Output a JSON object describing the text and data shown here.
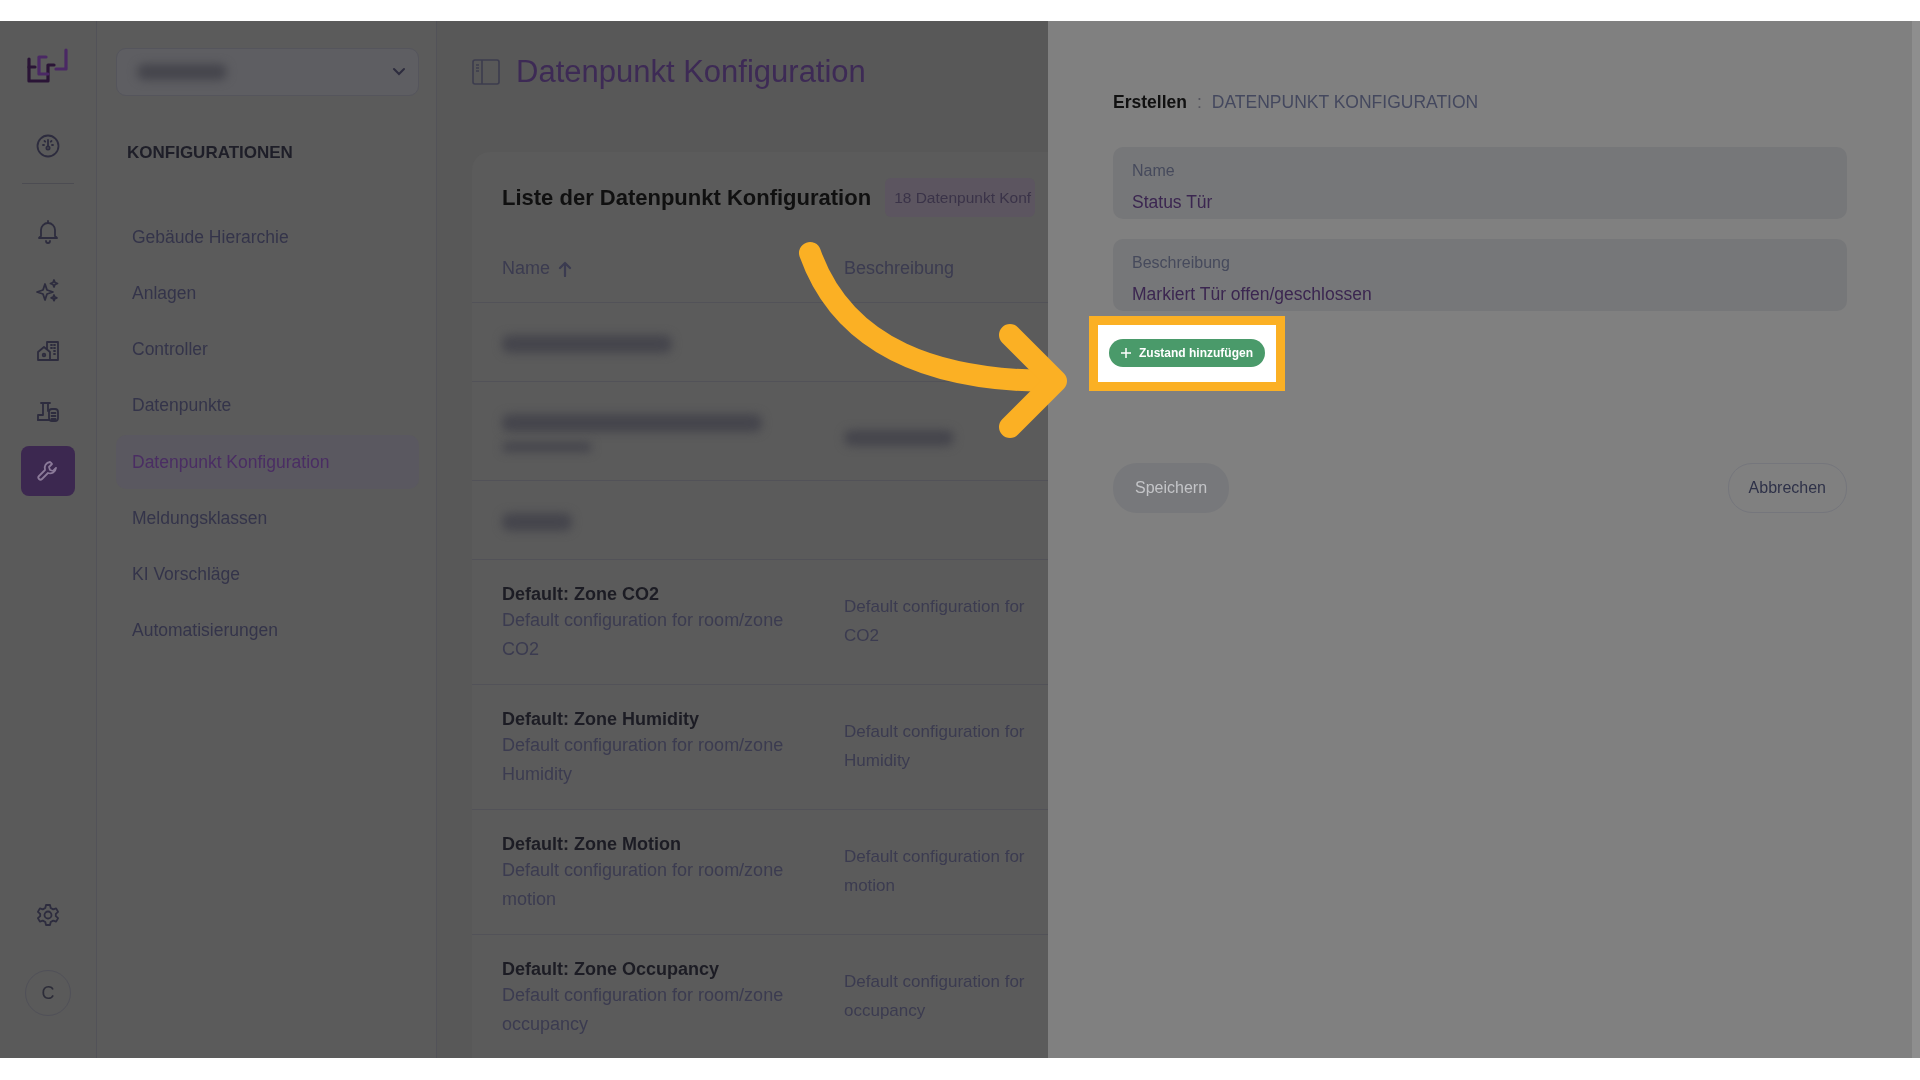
{
  "rail": {
    "items": [
      {
        "kind": "gauge",
        "selected": false
      },
      {
        "kind": "bell",
        "selected": false
      },
      {
        "kind": "sparkles",
        "selected": false
      },
      {
        "kind": "buildings",
        "selected": false
      },
      {
        "kind": "factory",
        "selected": false
      },
      {
        "kind": "wrench",
        "selected": true
      }
    ],
    "bottom": [
      {
        "kind": "settings"
      },
      {
        "kind": "avatar",
        "initial": "C"
      }
    ]
  },
  "nav": {
    "heading": "KONFIGURATIONEN",
    "items": [
      {
        "label": "Gebäude Hierarchie",
        "selected": false
      },
      {
        "label": "Anlagen",
        "selected": false
      },
      {
        "label": "Controller",
        "selected": false
      },
      {
        "label": "Datenpunkte",
        "selected": false
      },
      {
        "label": "Datenpunkt Konfiguration",
        "selected": true
      },
      {
        "label": "Meldungsklassen",
        "selected": false
      },
      {
        "label": "KI Vorschläge",
        "selected": false
      },
      {
        "label": "Automatisierungen",
        "selected": false
      }
    ]
  },
  "main": {
    "title": "Datenpunkt Konfiguration",
    "card": {
      "title": "Liste der Datenpunkt Konfiguration",
      "badge": "18 Datenpunkt Konf",
      "columns": [
        {
          "label": "Name",
          "sorted": true
        },
        {
          "label": "Beschreibung",
          "sorted": false
        }
      ],
      "rows": [
        {
          "kind": "redacted"
        },
        {
          "kind": "redacted"
        },
        {
          "kind": "redacted"
        },
        {
          "kind": "entry",
          "name": "Default: Zone CO2",
          "subtitle": "Default configuration for room/zone CO2",
          "description": "Default configuration for CO2"
        },
        {
          "kind": "entry",
          "name": "Default: Zone Humidity",
          "subtitle": "Default configuration for room/zone Humidity",
          "description": "Default configuration for Humidity"
        },
        {
          "kind": "entry",
          "name": "Default: Zone Motion",
          "subtitle": "Default configuration for room/zone motion",
          "description": "Default configuration for motion"
        },
        {
          "kind": "entry",
          "name": "Default: Zone Occupancy",
          "subtitle": "Default configuration for room/zone occupancy",
          "description": "Default configuration for occupancy"
        }
      ]
    }
  },
  "drawer": {
    "breadcrumb": {
      "action": "Erstellen",
      "separator": ":",
      "entity": "DATENPUNKT KONFIGURATION"
    },
    "fields": [
      {
        "label": "Name",
        "value": "Status Tür"
      },
      {
        "label": "Beschreibung",
        "value": "Markiert Tür offen/geschlossen"
      }
    ],
    "add_button": {
      "label": "Zustand hinzufügen",
      "highlighted": true
    },
    "save_button": {
      "label": "Speichern",
      "disabled": true
    },
    "cancel_button": {
      "label": "Abbrechen",
      "disabled": false
    }
  }
}
